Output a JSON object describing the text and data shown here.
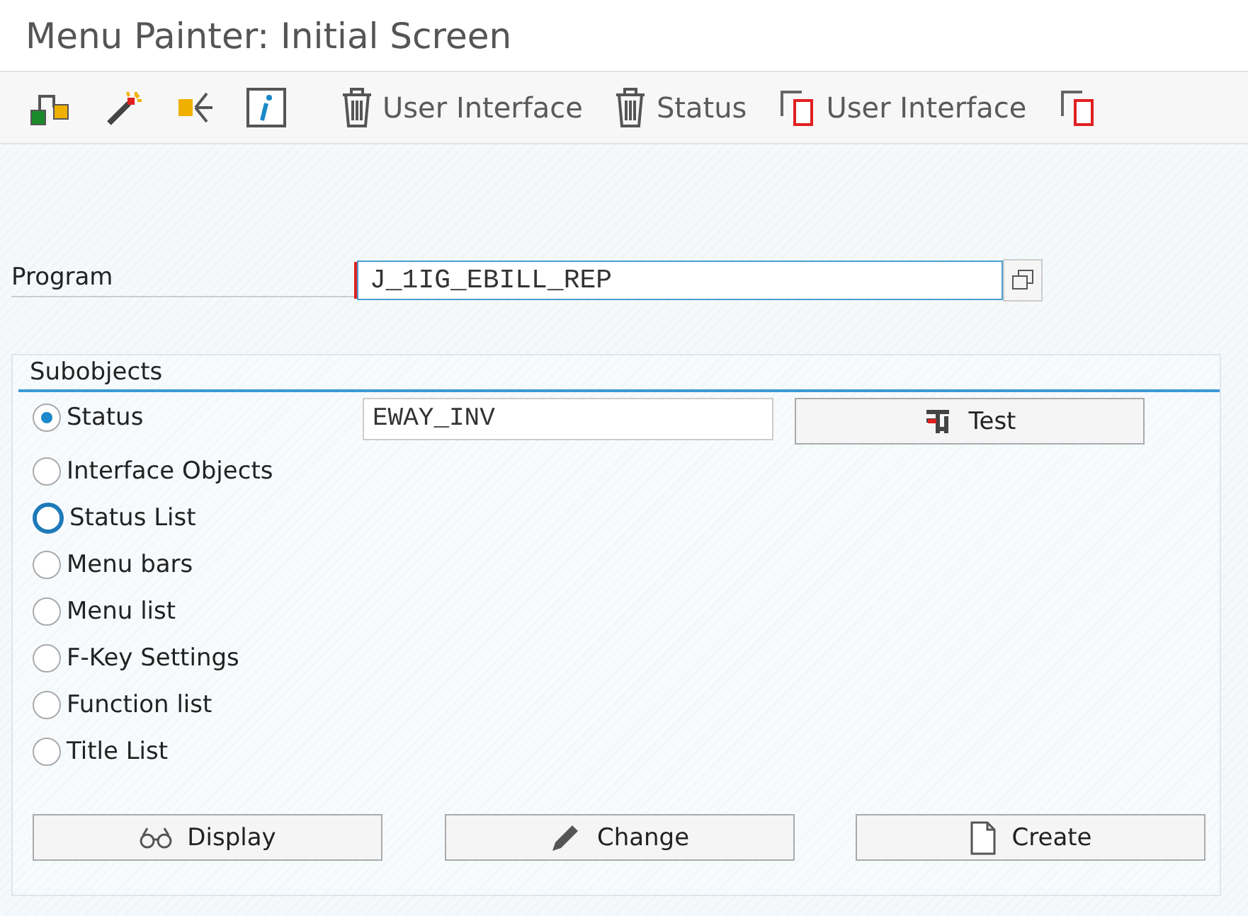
{
  "window": {
    "title": "Menu Painter: Initial Screen"
  },
  "toolbar": [
    {
      "kind": "icon"
    },
    {
      "kind": "icon"
    },
    {
      "kind": "icon"
    },
    {
      "kind": "icon"
    },
    {
      "kind": "labeled",
      "label": "User Interface"
    },
    {
      "kind": "labeled",
      "label": "Status"
    },
    {
      "kind": "labeled",
      "label": "User Interface"
    },
    {
      "kind": "icon"
    }
  ],
  "program": {
    "label": "Program",
    "value": "J_1IG_EBILL_REP"
  },
  "subobjects": {
    "title": "Subobjects",
    "options": [
      {
        "label": "Status",
        "selected": true,
        "focused": false,
        "value": "EWAY_INV"
      },
      {
        "label": "Interface Objects",
        "selected": false,
        "focused": false
      },
      {
        "label": "Status List",
        "selected": false,
        "focused": true
      },
      {
        "label": "Menu bars",
        "selected": false,
        "focused": false
      },
      {
        "label": "Menu list",
        "selected": false,
        "focused": false
      },
      {
        "label": "F-Key Settings",
        "selected": false,
        "focused": false
      },
      {
        "label": "Function list",
        "selected": false,
        "focused": false
      },
      {
        "label": "Title List",
        "selected": false,
        "focused": false
      }
    ],
    "test_button": "Test",
    "buttons": [
      "Display",
      "Change",
      "Create"
    ]
  }
}
